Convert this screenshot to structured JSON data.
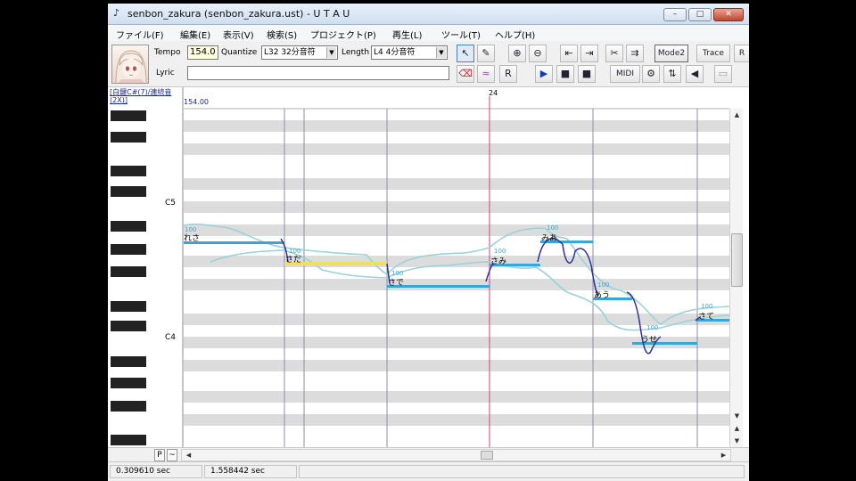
{
  "window": {
    "title": "senbon_zakura (senbon_zakura.ust) - U T A U",
    "controls": {
      "minimize": "–",
      "maximize": "□",
      "close": "✕"
    }
  },
  "menu": [
    {
      "label": "ファイル(F)"
    },
    {
      "label": "編集(E)"
    },
    {
      "label": "表示(V)"
    },
    {
      "label": "検索(S)"
    },
    {
      "label": "プロジェクト(P)"
    },
    {
      "label": "再生(L)"
    },
    {
      "label": "ツール(T)"
    },
    {
      "label": "ヘルプ(H)"
    }
  ],
  "toolbar": {
    "tempo_label": "Tempo",
    "tempo_value": "154.0",
    "quantize_label": "Quantize",
    "quantize_value": "L32 32分音符",
    "length_label": "Length",
    "length_value": "L4  4分音符",
    "lyric_label": "Lyric",
    "lyric_value": "",
    "midi_label": "MIDI",
    "mode2_label": "Mode2",
    "trace_label": "Trace",
    "r_label": "R",
    "icons": [
      "cursor-icon",
      "pencil-icon",
      "zoom-in-icon",
      "zoom-out-icon",
      "go-start-icon",
      "go-end-icon",
      "split-icon",
      "merge-icon",
      "play-icon",
      "pause-icon",
      "stop-icon",
      "eraser-icon",
      "vibrato-icon",
      "rest-icon",
      "gear-icon",
      "loop-icon",
      "volume-icon"
    ]
  },
  "roll": {
    "track_info": "[白鍵C#(7)/連続音(2X)]",
    "tempo_mark": "154.00",
    "bar_number": "24",
    "octave_labels": {
      "c5": "C5",
      "c4": "C4"
    },
    "notes": [
      {
        "lyric": "れさ",
        "vel": "100"
      },
      {
        "lyric": "さだ",
        "vel": "100"
      },
      {
        "lyric": "さで",
        "vel": "100"
      },
      {
        "lyric": "さみ",
        "vel": "100"
      },
      {
        "lyric": "みあ",
        "vel": "100"
      },
      {
        "lyric": "あう",
        "vel": "100"
      },
      {
        "lyric": "うせ",
        "vel": "100"
      },
      {
        "lyric": "さて",
        "vel": "100"
      }
    ]
  },
  "status": {
    "left_time": "0.309610 sec",
    "right_time": "1.558442 sec"
  },
  "bottom": {
    "p_button": "P",
    "tilde_button": "~"
  }
}
